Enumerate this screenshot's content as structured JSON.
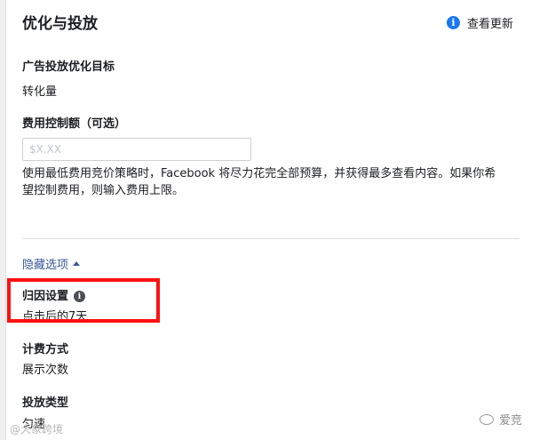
{
  "header": {
    "title": "优化与投放",
    "update_link": "查看更新",
    "info_icon_glyph": "i"
  },
  "optimization": {
    "label": "广告投放优化目标",
    "value": "转化量"
  },
  "cost_control": {
    "label": "费用控制额（可选）",
    "placeholder": "$X.XX",
    "help": "使用最低费用竞价策略时，Facebook 将尽力花完全部预算，并获得最多查看内容。如果你希望控制费用，则输入费用上限。"
  },
  "options_toggle": {
    "label": "隐藏选项"
  },
  "attribution": {
    "label": "归因设置",
    "value": "点击后的7天",
    "info_icon_glyph": "i",
    "highlight_color": "#ff1010"
  },
  "billing": {
    "label": "计费方式",
    "value": "展示次数"
  },
  "delivery_type": {
    "label": "投放类型",
    "value": "匀速"
  },
  "watermarks": {
    "left": "@大象跨境",
    "right": "爱竞"
  },
  "colors": {
    "accent_blue": "#1877f2",
    "link_blue": "#385898"
  }
}
